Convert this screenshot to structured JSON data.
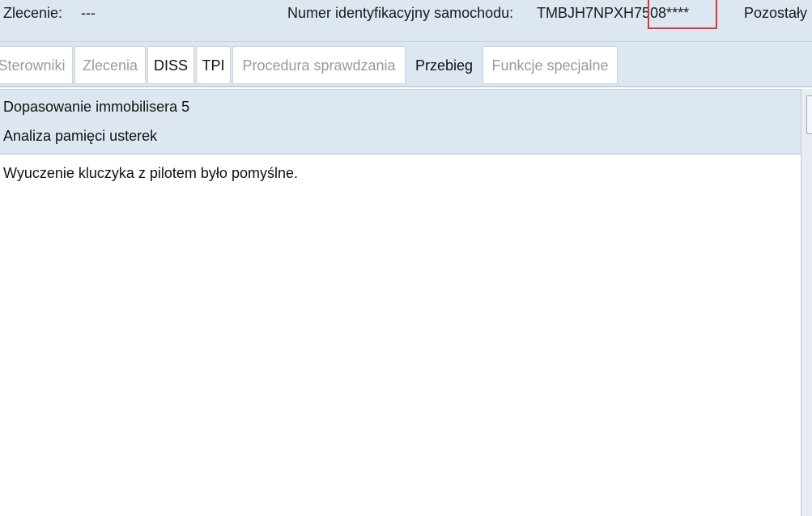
{
  "header": {
    "order_label": "Zlecenie:",
    "order_value": "---",
    "vin_label": "Numer identyfikacyjny samochodu:",
    "vin_value": "TMBJH7NPXH7508****",
    "remaining_label": "Pozostały"
  },
  "tabs": [
    {
      "label": "Sterowniki",
      "state": "disabled"
    },
    {
      "label": "Zlecenia",
      "state": "disabled"
    },
    {
      "label": "DISS",
      "state": "enabled"
    },
    {
      "label": "TPI",
      "state": "enabled"
    },
    {
      "label": "Procedura sprawdzania",
      "state": "disabled"
    },
    {
      "label": "Przebieg",
      "state": "selected"
    },
    {
      "label": "Funkcje specjalne",
      "state": "disabled"
    }
  ],
  "steps": [
    {
      "label": "Dopasowanie immobilisera 5"
    },
    {
      "label": "Analiza pamięci usterek"
    }
  ],
  "message": "Wyuczenie kluczyka z pilotem było pomyślne.",
  "colors": {
    "highlight": "#d23a3a",
    "panel": "#dde7f2",
    "disabled_text": "#9a9a9a"
  }
}
